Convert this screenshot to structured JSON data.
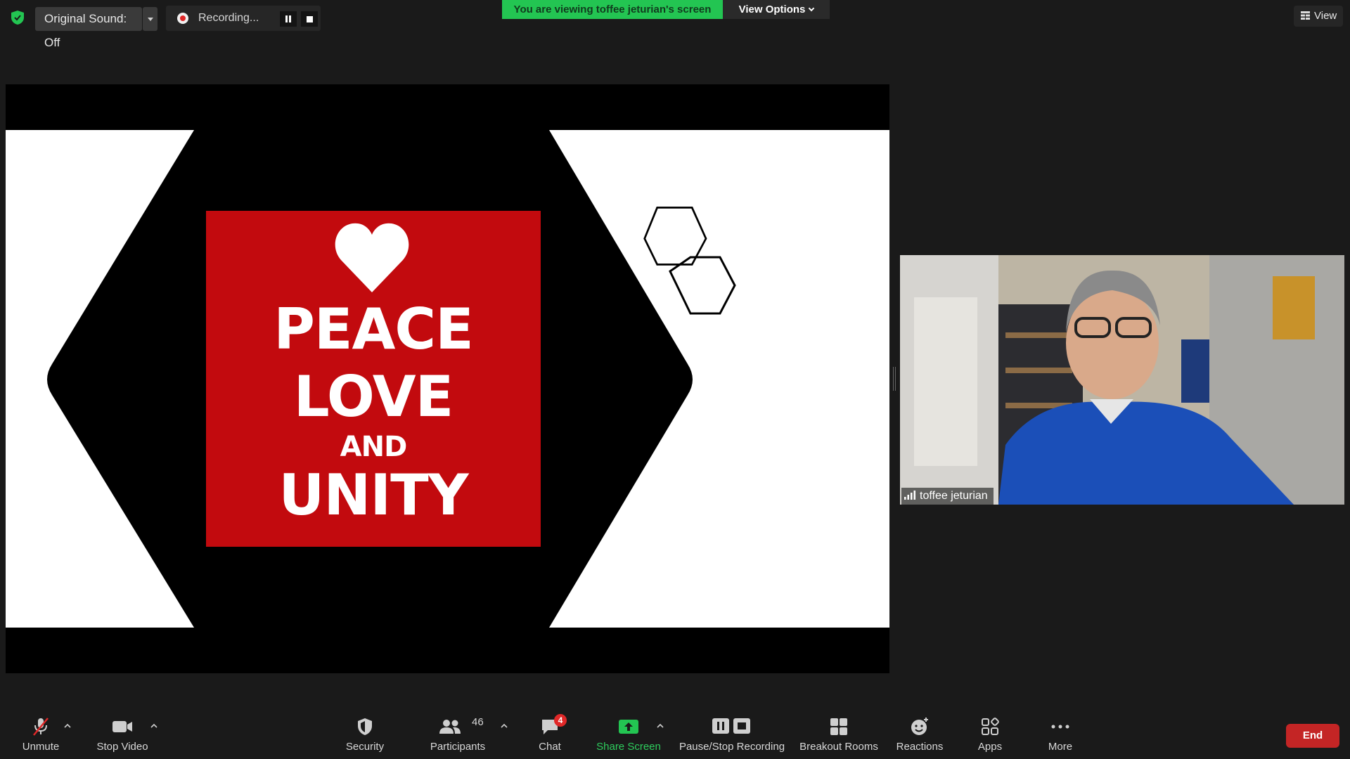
{
  "top_bar": {
    "original_sound_label": "Original Sound: Off",
    "recording_label": "Recording...",
    "viewing_banner": "You are viewing toffee jeturian's screen",
    "view_options_label": "View Options",
    "view_label": "View"
  },
  "shared_screen": {
    "poster_lines": [
      "PEACE",
      "LOVE",
      "AND",
      "UNITY"
    ],
    "poster_color": "#c20a0e"
  },
  "participant": {
    "name": "toffee jeturian"
  },
  "toolbar": {
    "unmute_label": "Unmute",
    "stop_video_label": "Stop Video",
    "security_label": "Security",
    "participants_label": "Participants",
    "participants_count": "46",
    "chat_label": "Chat",
    "chat_badge": "4",
    "share_screen_label": "Share Screen",
    "pause_stop_recording_label": "Pause/Stop Recording",
    "breakout_rooms_label": "Breakout Rooms",
    "reactions_label": "Reactions",
    "apps_label": "Apps",
    "more_label": "More",
    "end_label": "End"
  },
  "colors": {
    "share_green": "#23c552",
    "end_red": "#c42525",
    "badge_red": "#e02828"
  }
}
